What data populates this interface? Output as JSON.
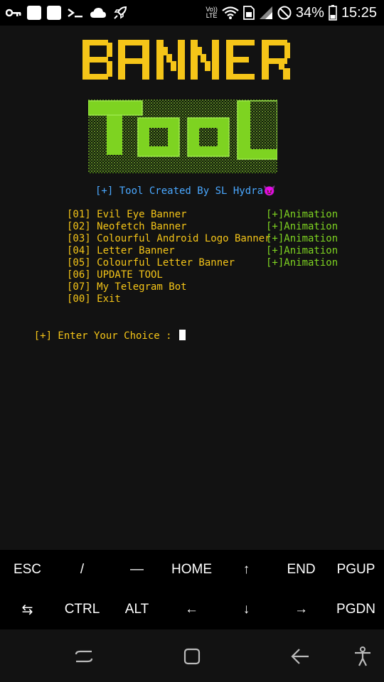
{
  "status_bar": {
    "battery_percent": "34%",
    "time": "15:25",
    "volte_top": "Vo))",
    "volte_bottom": "LTE",
    "left_icons": [
      "key-icon",
      "notification-square-icon",
      "notification-square-icon",
      "terminal-icon",
      "cloud-icon",
      "rocket-icon"
    ],
    "right_icons": [
      "volte-icon",
      "wifi-icon",
      "sim-icon",
      "signal-icon",
      "do-not-disturb-icon",
      "battery-icon"
    ]
  },
  "terminal": {
    "banner_line1": "BANNER",
    "banner_line2": "TOOL",
    "created_by": "[+] Tool Created By SL Hydra😈",
    "menu": [
      {
        "label": "[01] Evil Eye Banner",
        "tag": "[+]Animation"
      },
      {
        "label": "[02] Neofetch Banner",
        "tag": "[+]Animation"
      },
      {
        "label": "[03] Colourful Android Logo Banner",
        "tag": "[+]Animation"
      },
      {
        "label": "[04] Letter Banner",
        "tag": "[+]Animation"
      },
      {
        "label": "[05] Colourful Letter Banner",
        "tag": "[+]Animation"
      },
      {
        "label": "[06] UPDATE TOOL",
        "tag": ""
      },
      {
        "label": "[07] My Telegram Bot",
        "tag": ""
      },
      {
        "label": "[00] Exit",
        "tag": ""
      }
    ],
    "prompt": "[+] Enter Your Choice : "
  },
  "extra_keys": {
    "row1": [
      "ESC",
      "/",
      "—",
      "HOME",
      "↑",
      "END",
      "PGUP"
    ],
    "row2": [
      "⇆",
      "CTRL",
      "ALT",
      "←",
      "↓",
      "→",
      "PGDN"
    ]
  },
  "colors": {
    "yellow": "#f5c518",
    "green": "#7ed321",
    "blue": "#4aa8ff",
    "terminal_bg": "#121212"
  }
}
